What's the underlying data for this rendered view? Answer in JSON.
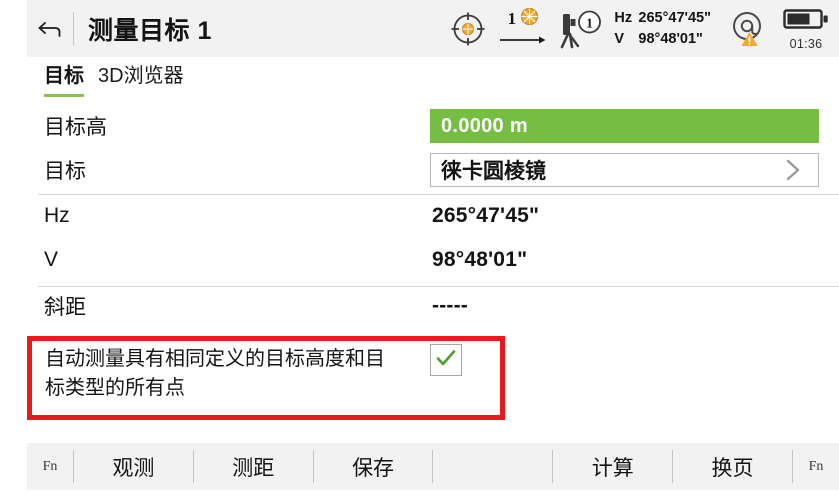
{
  "header": {
    "back_icon": "back-arrow-icon",
    "title": "测量目标 1",
    "status": {
      "target_icon": "crosshair-target-icon",
      "prism_count": "1",
      "prism_icon": "prism-icon",
      "arrow_icon": "arrow-right-icon",
      "instrument_icon": "total-station-icon",
      "instrument_badge": "1",
      "hz_key": "Hz",
      "hz_value": "265°47'45\"",
      "v_key": "V",
      "v_value": "98°48'01\"",
      "at_icon": "at-sign-warning-icon",
      "battery_icon": "battery-icon",
      "battery_time": "01:36"
    }
  },
  "tabs": [
    {
      "label": "目标",
      "active": true
    },
    {
      "label": "3D浏览器",
      "active": false
    }
  ],
  "rows": [
    {
      "label": "目标高",
      "value": "0.0000 m",
      "kind": "field-green"
    },
    {
      "label": "目标",
      "value": "徕卡圆棱镜",
      "kind": "field-white",
      "chevron": "chevron-right-icon"
    },
    {
      "label": "Hz",
      "value": "265°47'45\"",
      "kind": "text"
    },
    {
      "label": "V",
      "value": "98°48'01\"",
      "kind": "text"
    },
    {
      "label": "斜距",
      "value": "-----",
      "kind": "text"
    }
  ],
  "auto_measure": {
    "text": "自动测量具有相同定义的目标高度和目标类型的所有点",
    "checked": true,
    "check_icon": "checkmark-icon",
    "highlight_color": "#e8181c"
  },
  "toolbar": {
    "fn_left": "Fn",
    "fn_right": "Fn",
    "buttons": [
      "观测",
      "测距",
      "保存",
      "",
      "计算",
      "换页"
    ]
  },
  "colors": {
    "accent_green": "#76bd43",
    "tab_underline": "#8cc152",
    "header_bg": "#f2f2f2",
    "annotation_red": "#e8181c",
    "prism_orange": "#f0a830"
  }
}
